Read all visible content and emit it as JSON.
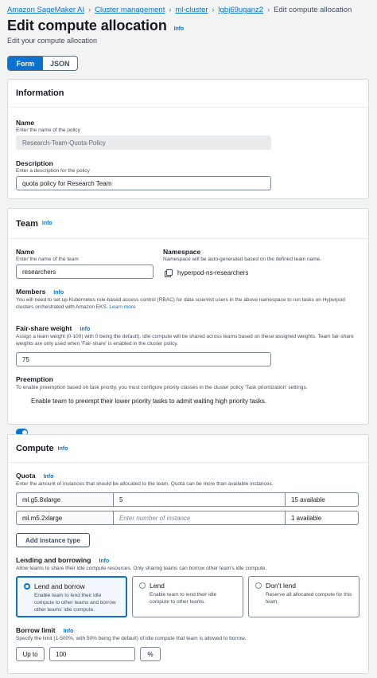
{
  "breadcrumbs": [
    "Amazon SageMaker AI",
    "Cluster management",
    "ml-cluster",
    "lgbj69uganz2",
    "Edit compute allocation"
  ],
  "page": {
    "title": "Edit compute allocation",
    "info": "Info",
    "subtitle": "Edit your compute allocation"
  },
  "mode_tabs": [
    "Form",
    "JSON"
  ],
  "information": {
    "heading": "Information",
    "name_label": "Name",
    "name_desc": "Enter the name of the policy",
    "name_value": "Research-Team-Quota-Policy",
    "description_label": "Description",
    "description_desc": "Enter a description for the policy",
    "description_value": "quota policy for Research Team"
  },
  "team": {
    "heading": "Team",
    "info": "Info",
    "name_label": "Name",
    "name_desc": "Enter the name of the team",
    "name_value": "researchers",
    "namespace_label": "Namespace",
    "namespace_desc": "Namespace will be auto-generated based on the defined team name.",
    "namespace_value": "hyperpod-ns-researchers",
    "members_label": "Members",
    "members_info": "Info",
    "members_desc": "You will need to set up Kubernetes role-based access control (RBAC) for data scientist users in the above namespace to run tasks on Hyperpod clusters orchestrated with Amazon EKS.",
    "members_link": "Learn more",
    "weight_label": "Fair-share weight",
    "weight_info": "Info",
    "weight_desc": "Assign a team weight (0-100) with 0 being the default). Idle compute will be shared across teams based on these assigned weights. Team fair-share weights are only used when 'Fair-share' is enabled in the cluster policy.",
    "weight_value": "75",
    "preemption_label": "Preemption",
    "preemption_desc": "To enable preemption based on task priority, you must configure priority classes in the cluster policy 'Task prioritization' settings.",
    "preemption_toggle_label": "Enable team to preempt their lower priority tasks to admit waiting high priority tasks.",
    "preemption_enabled": true
  },
  "compute": {
    "heading": "Compute",
    "info": "Info",
    "quota_label": "Quota",
    "quota_info": "Info",
    "quota_desc": "Enter the amount of instances that should be allocated to the team. Quota can be more than available instances.",
    "rows": [
      {
        "type": "ml.g5.8xlarge",
        "value": "5",
        "placeholder": "",
        "available": "15 available"
      },
      {
        "type": "ml.m5.2xlarge",
        "value": "",
        "placeholder": "Enter number of instance",
        "available": "1 available"
      }
    ],
    "add_button": "Add instance type",
    "lending_label": "Lending and borrowing",
    "lending_info": "Info",
    "lending_desc": "Allow teams to share their idle compute resources. Only sharing teams can borrow other team's idle compute.",
    "options": [
      {
        "title": "Lend and borrow",
        "desc": "Enable team to lend their idle compute to other teams and borrow other teams' idle compute.",
        "selected": true
      },
      {
        "title": "Lend",
        "desc": "Enable team to lend their idle compute to other teams.",
        "selected": false
      },
      {
        "title": "Don't lend",
        "desc": "Reserve all allocated compute for this team.",
        "selected": false
      }
    ],
    "borrow_label": "Borrow limit",
    "borrow_info": "Info",
    "borrow_desc": "Specify the limit (1-500%, with 50% being the default) of idle compute that team is allowed to borrow.",
    "borrow_prefix": "Up to",
    "borrow_value": "100",
    "borrow_unit": "%"
  },
  "colors": {
    "accent": "#0972d3",
    "page_bg": "#f2f3f3",
    "panel_border": "#d5dbdb"
  }
}
